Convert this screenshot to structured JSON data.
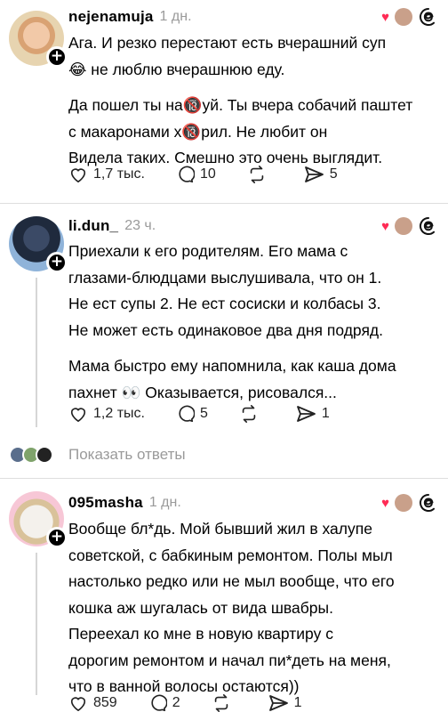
{
  "posts": [
    {
      "username": "nejenamuja",
      "time": "1 дн.",
      "paragraphs": [
        "Ага. И резко перестают есть вчерашний суп\n😂 не люблю вчерашнюю еду.",
        "Да пошел ты на🔞уй. Ты вчера собачий паштет\nс макаронами х🔞рил. Не любит он\nВидела таких. Смешно это очень выглядит."
      ],
      "likes": "1,7 тыс.",
      "comments": "10",
      "reposts": "",
      "shares": "5"
    },
    {
      "username": "li.dun_",
      "time": "23 ч.",
      "paragraphs": [
        "Приехали к его родителям. Его мама с\nглазами-блюдцами выслушивала, что он 1.\nНе ест супы 2. Не ест сосиски и колбасы 3.\nНе может есть одинаковое два дня подряд.",
        "Мама быстро ему напомнила, как каша дома\nпахнет 👀 Оказывается, рисовался..."
      ],
      "likes": "1,2 тыс.",
      "comments": "5",
      "reposts": "",
      "shares": "1"
    },
    {
      "username": "095masha",
      "time": "1 дн.",
      "paragraphs": [
        "Вообще бл*дь. Мой бывший жил в халупе\nсоветской, с бабкиным ремонтом. Полы мыл\nнастолько редко или не мыл вообще, что его\nкошка аж шугалась от вида швабры.\nПереехал ко мне в новую квартиру с\nдорогим ремонтом и начал пи*деть на меня,\nчто в ванной волосы остаются))"
      ],
      "likes": "859",
      "comments": "2",
      "reposts": "",
      "shares": "1"
    }
  ],
  "show_replies": "Показать ответы",
  "icons": {
    "like": "heart-outline-icon",
    "comment": "speech-bubble-icon",
    "repost": "repost-arrows-icon",
    "share": "send-arrow-icon",
    "threads": "threads-logo-icon",
    "follow": "plus-icon"
  },
  "colors": {
    "heart": "#ff2b55",
    "muted": "#9a9a9a",
    "divider": "#dedede"
  }
}
